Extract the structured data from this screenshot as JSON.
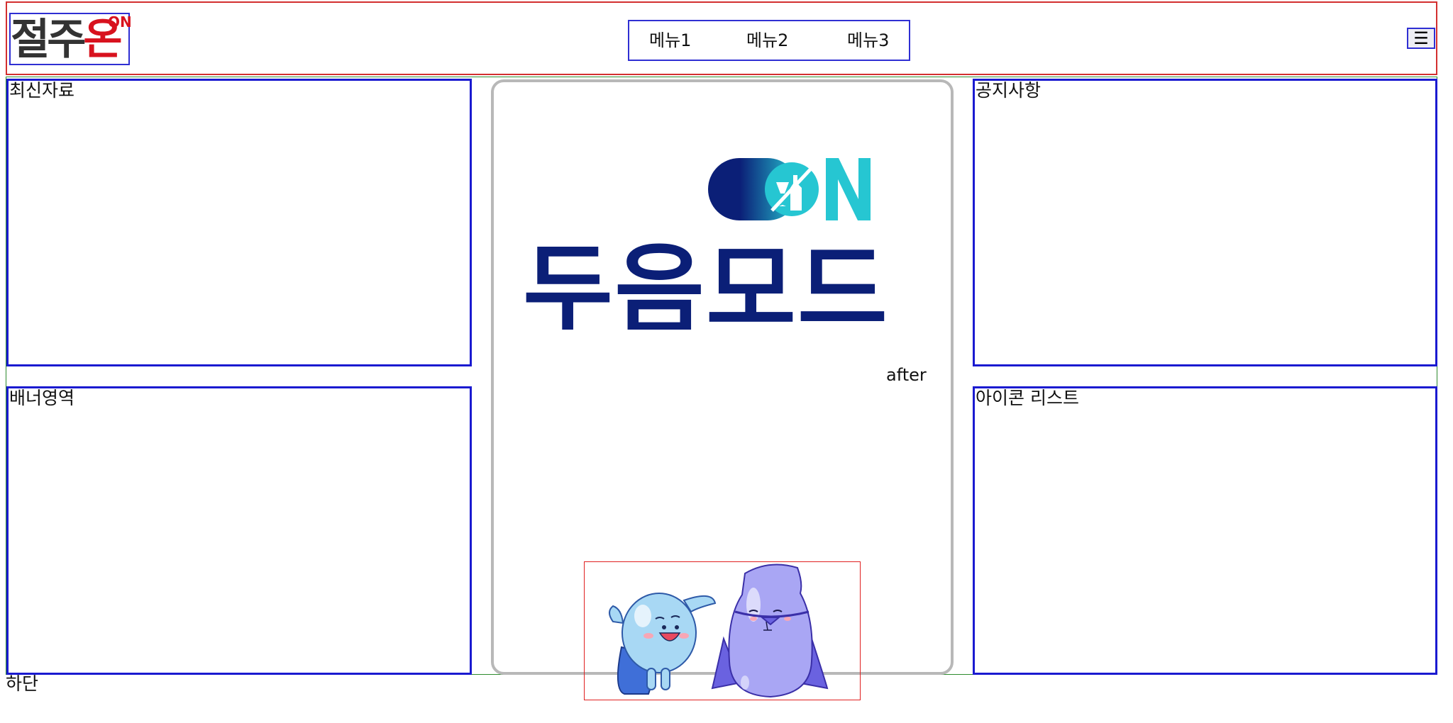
{
  "header": {
    "logo": {
      "text_main": "절주",
      "text_accent": "온",
      "superscript": "ON"
    },
    "nav": {
      "items": [
        {
          "label": "메뉴1"
        },
        {
          "label": "메뉴2"
        },
        {
          "label": "메뉴3"
        }
      ]
    },
    "menu_toggle": {
      "icon": "☰",
      "icon_name": "hamburger-menu-icon"
    }
  },
  "panels": {
    "recent": {
      "title": "최신자료"
    },
    "banner": {
      "title": "배너영역"
    },
    "notice": {
      "title": "공지사항"
    },
    "icon_list": {
      "title": "아이콘 리스트"
    }
  },
  "center": {
    "brand_on_text": "ON",
    "brand_main_text": "두음모드",
    "after_label": "after",
    "mascot_name": "two-blob-mascots"
  },
  "footer": {
    "label": "하단"
  },
  "colors": {
    "header_border": "#d32f2f",
    "panel_border": "#1a1ad0",
    "main_frame_border": "#2e8b2e",
    "brand_navy": "#0b1f77",
    "brand_teal": "#26c6d2",
    "logo_red": "#d8121e",
    "card_border": "#b8b8b8"
  }
}
